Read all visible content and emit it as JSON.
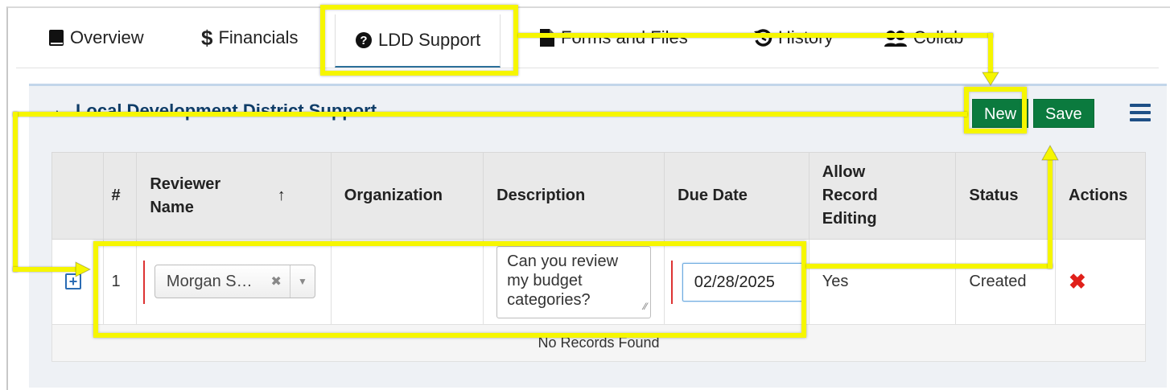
{
  "tabs": [
    {
      "label": "Overview",
      "icon": "book-icon"
    },
    {
      "label": "Financials",
      "icon": "dollar-icon"
    },
    {
      "label": "LDD Support",
      "icon": "question-circle-icon",
      "active": true
    },
    {
      "label": "Forms and Files",
      "icon": "file-icon"
    },
    {
      "label": "History",
      "icon": "history-icon"
    },
    {
      "label": "Collab",
      "icon": "users-icon"
    }
  ],
  "panel": {
    "title": "Local Development District Support",
    "collapse_icon": "caret-up-icon",
    "new_label": "New",
    "save_label": "Save",
    "menu_icon": "hamburger-icon"
  },
  "table": {
    "headers": {
      "num": "#",
      "reviewer_line1": "Reviewer",
      "reviewer_line2": "Name",
      "sort_indicator": "↑",
      "organization": "Organization",
      "description": "Description",
      "due_date": "Due Date",
      "allow_line1": "Allow",
      "allow_line2": "Record",
      "allow_line3": "Editing",
      "status": "Status",
      "actions": "Actions"
    },
    "row": {
      "num": "1",
      "reviewer": "Morgan S…",
      "organization": "",
      "description_lines": [
        "Can you review",
        "my budget",
        "categories?"
      ],
      "due_date": "02/28/2025",
      "allow_editing": "Yes",
      "status": "Created"
    },
    "empty_message": "No Records Found"
  },
  "colors": {
    "highlight": "#f6f600",
    "button_green": "#0b7a3e",
    "title_blue": "#0f3d68",
    "delete_red": "#e0201a"
  }
}
